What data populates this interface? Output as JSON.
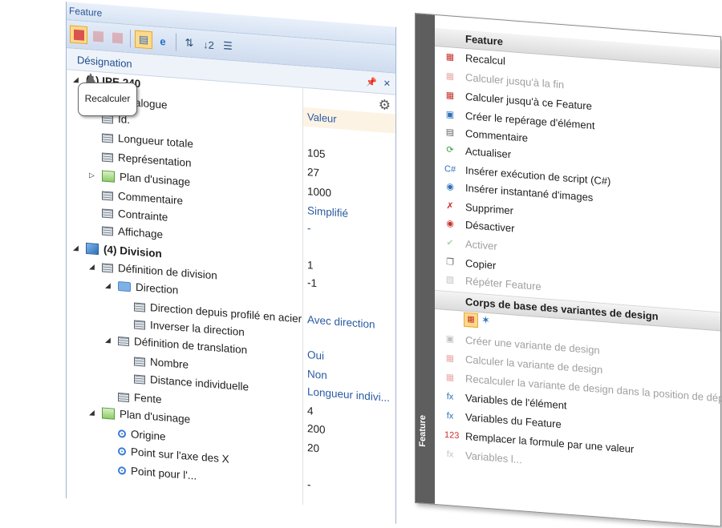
{
  "left_panel": {
    "title": "Feature",
    "header_label": "Désignation",
    "value_header": "Valeur",
    "tooltip": "Recalculer",
    "header_icons": {
      "pin": "pin-icon",
      "close": "close-icon"
    },
    "toolbar_icons": [
      "recalc-icon",
      "calc-to-end-icon",
      "calc-to-feature-icon",
      "feature-active-icon",
      "e-icon",
      "sort-icon",
      "sort-numeric-icon",
      "filter-icon"
    ],
    "rows": [
      {
        "name": "(1) IPE 240",
        "value": ""
      },
      {
        "name": "Catalogue",
        "value": "Valeur"
      },
      {
        "name": "Id.",
        "value": ""
      },
      {
        "name": "Longueur totale",
        "value": "105"
      },
      {
        "name": "Représentation",
        "value": "27"
      },
      {
        "name": "Plan d'usinage",
        "value": "1000"
      },
      {
        "name": "Commentaire",
        "value": "Simplifié"
      },
      {
        "name": "Contrainte",
        "value": "-"
      },
      {
        "name": "Affichage",
        "value": ""
      },
      {
        "name": "(4) Division",
        "value": "1"
      },
      {
        "name": "Définition de division",
        "value": "-1"
      },
      {
        "name": "Direction",
        "value": ""
      },
      {
        "name": "Direction depuis profilé en acier",
        "value": "Avec direction"
      },
      {
        "name": "Inverser la direction",
        "value": ""
      },
      {
        "name": "Définition de translation",
        "value": "Oui"
      },
      {
        "name": "Nombre",
        "value": "Non"
      },
      {
        "name": "Distance individuelle",
        "value": "Longueur indivi..."
      },
      {
        "name": "Fente",
        "value": "4"
      },
      {
        "name": "Plan d'usinage",
        "value": "200"
      },
      {
        "name": "Origine",
        "value": "20"
      },
      {
        "name": "Point sur l'axe des X",
        "value": ""
      },
      {
        "name": "Point pour l'...",
        "value": "-"
      }
    ]
  },
  "menu": {
    "strip_label": "Feature",
    "section1": "Feature",
    "items1": [
      {
        "label": "Recalcul",
        "icon": "recalc-icon",
        "enabled": true
      },
      {
        "label": "Calculer jusqu'à la fin",
        "icon": "calc-to-end-icon",
        "enabled": false
      },
      {
        "label": "Calculer jusqu'à ce Feature",
        "icon": "calc-to-feature-icon",
        "enabled": true
      },
      {
        "label": "Créer le repérage d'élément",
        "icon": "marking-icon",
        "enabled": true
      },
      {
        "label": "Commentaire",
        "icon": "comment-icon",
        "enabled": true
      },
      {
        "label": "Actualiser",
        "icon": "refresh-icon",
        "enabled": true
      },
      {
        "label": "Insérer exécution de script (C#)",
        "icon": "csharp-icon",
        "enabled": true
      },
      {
        "label": "Insérer instantané d'images",
        "icon": "camera-icon",
        "enabled": true
      },
      {
        "label": "Supprimer",
        "icon": "delete-icon",
        "enabled": true
      },
      {
        "label": "Désactiver",
        "icon": "deactivate-icon",
        "enabled": true
      },
      {
        "label": "Activer",
        "icon": "activate-icon",
        "enabled": false
      },
      {
        "label": "Copier",
        "icon": "copy-icon",
        "enabled": true
      },
      {
        "label": "Répéter Feature",
        "icon": "repeat-icon",
        "enabled": false
      }
    ],
    "section2": "Corps de base des variantes de design",
    "items2": [
      {
        "label": "Créer une variante de design",
        "icon": "create-variant-icon",
        "enabled": false
      },
      {
        "label": "Calculer la variante de design",
        "icon": "calc-variant-icon",
        "enabled": false
      },
      {
        "label": "Recalculer la variante de design dans la position de départ",
        "icon": "recalc-variant-icon",
        "enabled": false
      },
      {
        "label": "Variables de l'élément",
        "icon": "element-variables-icon",
        "enabled": true
      },
      {
        "label": "Variables du Feature",
        "icon": "feature-variables-icon",
        "enabled": true
      },
      {
        "label": "Remplacer la formule par une valeur",
        "icon": "replace-formula-icon",
        "enabled": true
      },
      {
        "label": "Variables l...",
        "icon": "variables-icon",
        "enabled": false
      }
    ]
  }
}
